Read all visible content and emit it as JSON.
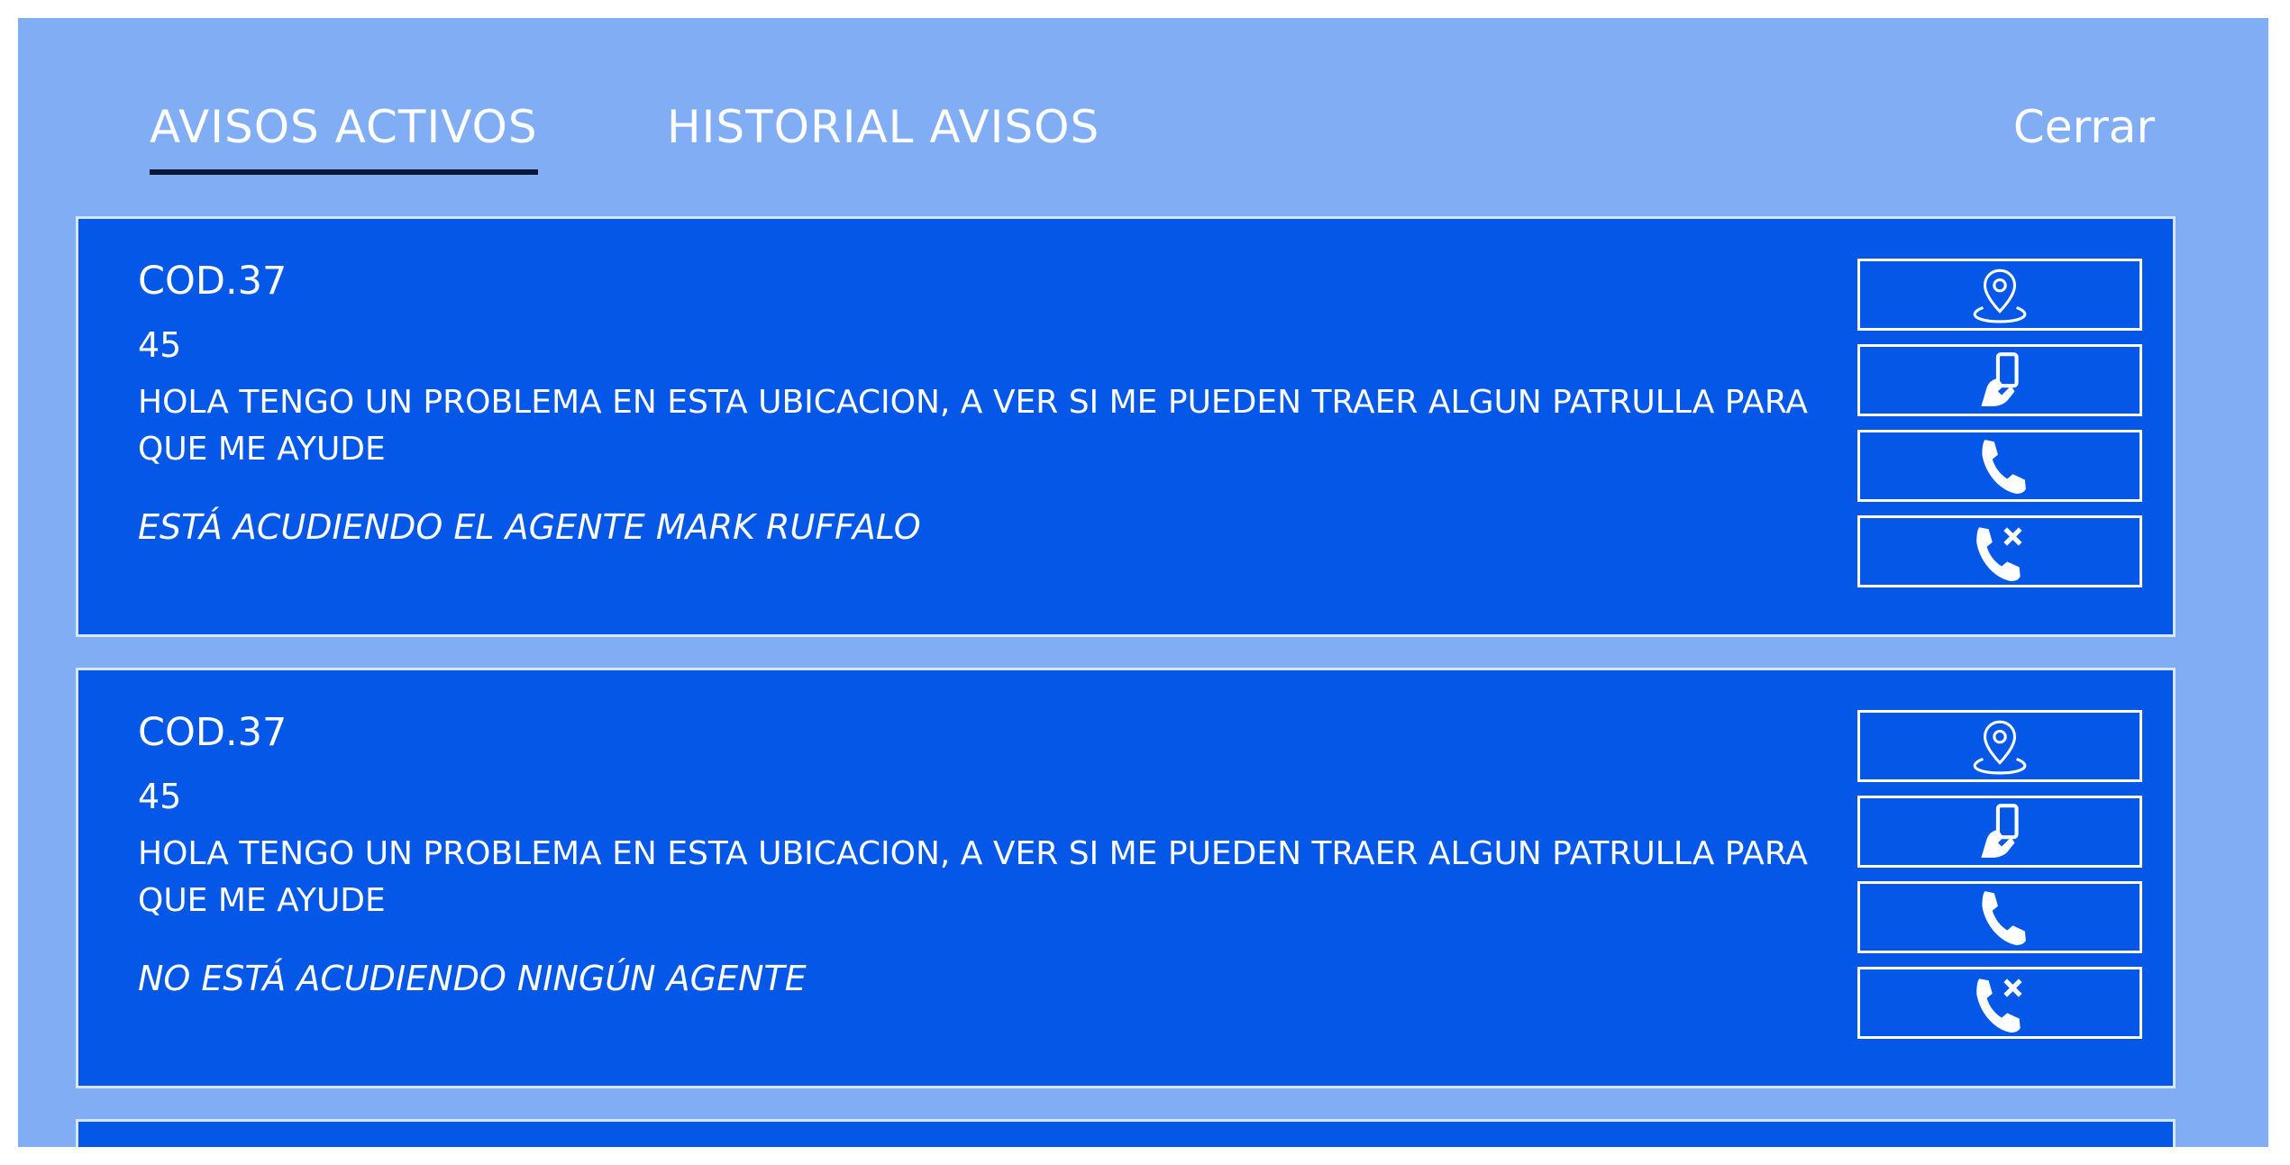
{
  "tabs": {
    "active_label": "AVISOS ACTIVOS",
    "history_label": "HISTORIAL AVISOS",
    "close_label": "Cerrar"
  },
  "alerts": [
    {
      "code": "COD.37",
      "number": "45",
      "message": "HOLA TENGO UN PROBLEMA EN ESTA UBICACION, A VER SI ME PUEDEN TRAER ALGUN PATRULLA PARA QUE ME AYUDE",
      "status": "ESTÁ ACUDIENDO EL AGENTE MARK RUFFALO",
      "actions": [
        "location-pin-icon",
        "hand-phone-icon",
        "phone-call-icon",
        "phone-hangup-icon"
      ]
    },
    {
      "code": "COD.37",
      "number": "45",
      "message": "HOLA TENGO UN PROBLEMA EN ESTA UBICACION, A VER SI ME PUEDEN TRAER ALGUN PATRULLA PARA QUE ME AYUDE",
      "status": "NO ESTÁ ACUDIENDO NINGÚN AGENTE",
      "actions": [
        "location-pin-icon",
        "hand-phone-icon",
        "phone-call-icon",
        "phone-hangup-icon"
      ]
    }
  ],
  "colors": {
    "panel_bg": "#81adf5",
    "card_bg": "#0558e7",
    "text": "#ffffff",
    "active_underline": "#0a1735"
  }
}
